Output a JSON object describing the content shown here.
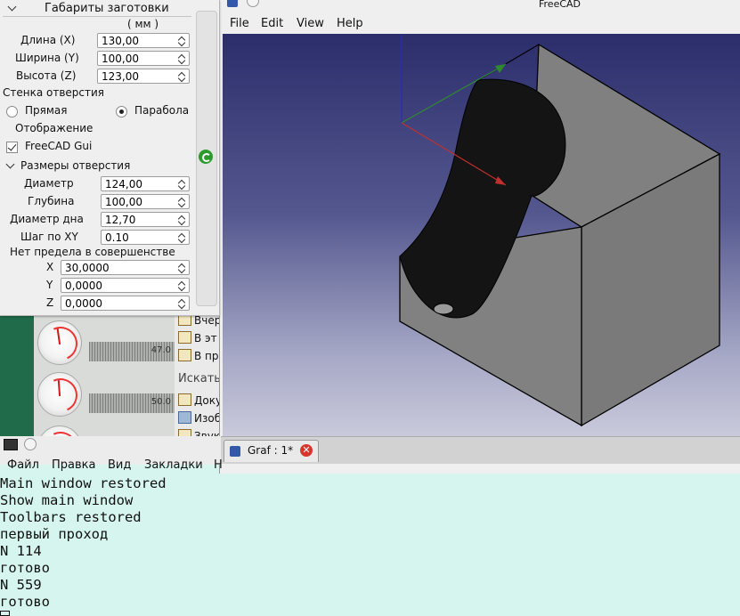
{
  "panel": {
    "section_blank": {
      "title": "Габариты заготовки",
      "unit": "( мм )"
    },
    "length": {
      "label": "Длина (X)",
      "value": "130,00"
    },
    "width": {
      "label": "Ширина (Y)",
      "value": "100,00"
    },
    "height": {
      "label": "Высота (Z)",
      "value": "123,00"
    },
    "wall_label": "Стенка отверстия",
    "wall_straight": "Прямая",
    "wall_parabola": "Парабола",
    "display_label": "Отображение",
    "gui_checkbox": "FreeCAD Gui",
    "section_hole": {
      "title": "Размеры отверстия"
    },
    "diameter": {
      "label": "Диаметр",
      "value": "124,00"
    },
    "depth": {
      "label": "Глубина",
      "value": "100,00"
    },
    "bottom_diameter": {
      "label": "Диаметр дна",
      "value": "12,70"
    },
    "xy_step": {
      "label": "Шаг по XY",
      "value": "0.10"
    },
    "perfection": "Нет предела в совершенстве",
    "coord_x": {
      "label": "X",
      "value": "30,0000"
    },
    "coord_y": {
      "label": "Y",
      "value": "0,0000"
    },
    "coord_z": {
      "label": "Z",
      "value": "0,0000"
    }
  },
  "freecad": {
    "title": "FreeCAD",
    "menu": [
      "File",
      "Edit",
      "View",
      "Help"
    ],
    "tab_label": "Graf : 1*"
  },
  "background": {
    "gauge_values": [
      "47.0",
      "50.0"
    ],
    "file_items": [
      "Вчер",
      "В эт",
      "В пр"
    ],
    "search_label": "Искать",
    "file_items2": [
      "Доку",
      "Изоб",
      "Звук"
    ]
  },
  "terminal": {
    "menu": [
      "Файл",
      "Правка",
      "Вид",
      "Закладки",
      "Н"
    ],
    "lines": [
      "Main window restored",
      "Show main window",
      "Toolbars restored",
      "первый проход",
      "N 114",
      "готово",
      "N 559",
      "готово",
      ""
    ]
  },
  "colors": {
    "axis_x": "#c0302c",
    "axis_y": "#2f8a2f",
    "axis_z": "#2a2ab0",
    "box_face": "#808080",
    "cavity": "#141414"
  }
}
